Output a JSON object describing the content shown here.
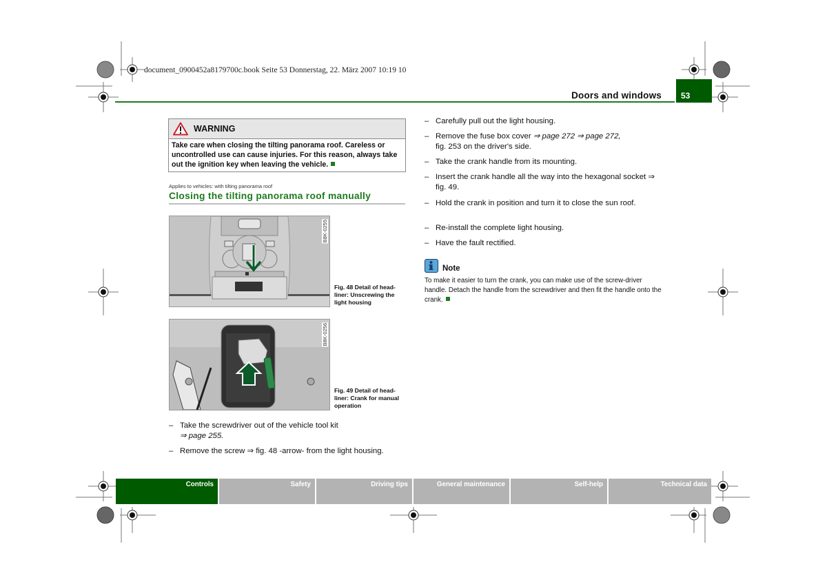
{
  "print_info": "document_0900452a8179700c.book  Seite 53  Donnerstag, 22. März 2007  10:19 10",
  "header": {
    "section_title": "Doors and windows",
    "page_number": "53"
  },
  "warning": {
    "title": "WARNING",
    "body": "Take care when closing the tilting panorama roof. Careless or uncontrolled use can cause injuries. For this reason, always take out the ignition key when leaving the vehicle."
  },
  "applies_to": "Applies to vehicles: with tilting panorama roof",
  "heading": "Closing the tilting panorama roof manually",
  "figures": [
    {
      "code": "B8K-0255",
      "caption": "Fig. 48   Detail of head-liner: Unscrewing the light housing"
    },
    {
      "code": "B8K-0256",
      "caption": "Fig. 49   Detail of head-liner: Crank for manual operation"
    }
  ],
  "steps_left": [
    {
      "dash": "–",
      "text": "Take the screwdriver out of the vehicle tool kit",
      "ref": "⇒ page 255."
    },
    {
      "dash": "–",
      "text": "Remove the screw ⇒ fig. 48  -arrow- from the light housing."
    }
  ],
  "steps_right": [
    {
      "dash": "–",
      "text": "Carefully pull out the light housing."
    },
    {
      "dash": "–",
      "text": "Remove the fuse box cover ",
      "ref": "⇒ page 272 ⇒ page 272,",
      "text2": " fig. 253 on the driver's side."
    },
    {
      "dash": "–",
      "text": "Take the crank handle from its mounting."
    },
    {
      "dash": "–",
      "text": "Insert the crank handle all the way into the hexagonal socket ⇒ fig. 49."
    },
    {
      "dash": "–",
      "text": "Hold the crank in position and turn it to close the sun roof."
    },
    {
      "dash": "–",
      "text": "Re-install the complete light housing."
    },
    {
      "dash": "–",
      "text": "Have the fault rectified."
    }
  ],
  "note": {
    "icon": "info-icon",
    "title": "Note",
    "body": "To make it easier to turn the crank, you can make use of the screw-driver handle. Detach the handle from the screwdriver and then fit the handle onto the crank."
  },
  "tabs": [
    {
      "label": "Controls",
      "active": true
    },
    {
      "label": "Safety",
      "active": false
    },
    {
      "label": "Driving tips",
      "active": false
    },
    {
      "label": "General maintenance",
      "active": false
    },
    {
      "label": "Self-help",
      "active": false
    },
    {
      "label": "Technical data",
      "active": false
    }
  ],
  "colors": {
    "brand_green": "#005a00",
    "accent_green": "#1e7a1e",
    "tab_gray": "#b3b3b3",
    "warning_red": "#d0202c",
    "info_blue": "#5aa8d8"
  }
}
